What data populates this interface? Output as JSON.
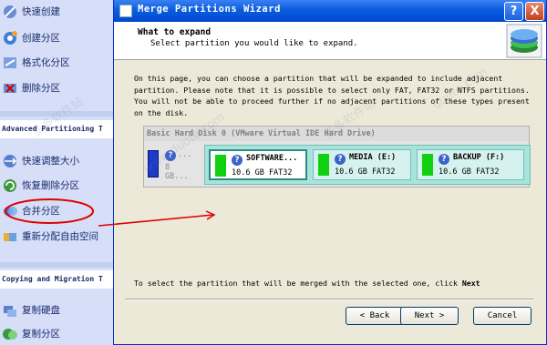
{
  "sidebar": {
    "items_top": [
      {
        "label": "快速创建",
        "icon": "wizard-icon"
      },
      {
        "label": "创建分区",
        "icon": "create-partition-icon"
      },
      {
        "label": "格式化分区",
        "icon": "format-partition-icon"
      },
      {
        "label": "删除分区",
        "icon": "delete-partition-icon"
      }
    ],
    "section_advanced": "Advanced Partitioning T",
    "items_advanced": [
      {
        "label": "快速调整大小",
        "icon": "resize-icon"
      },
      {
        "label": "恢复删除分区",
        "icon": "recover-icon"
      },
      {
        "label": "合并分区",
        "icon": "merge-icon"
      },
      {
        "label": "重新分配自由空间",
        "icon": "redistribute-icon"
      }
    ],
    "section_copy": "Copying and Migration T",
    "items_copy": [
      {
        "label": "复制硬盘",
        "icon": "copy-disk-icon"
      },
      {
        "label": "复制分区",
        "icon": "copy-partition-icon"
      }
    ]
  },
  "window": {
    "title": "Merge Partitions Wizard",
    "help_glyph": "?",
    "close_glyph": "X"
  },
  "header": {
    "title": "What to expand",
    "subtitle": "Select partition you would like to expand."
  },
  "description": [
    "On this page, you can choose a partition that will be expanded to include adjacent",
    "partition. Please note that it is possible to select only FAT, FAT32 or NTFS partitions.",
    "You will not be able to proceed further if no adjacent partitions of these types present",
    "on the disk."
  ],
  "disk": {
    "title": "Basic Hard Disk 0 (VMware Virtual IDE Hard Drive)",
    "small_partition": {
      "dots": "...",
      "size": "8 GB..."
    },
    "partitions": [
      {
        "name": "SOFTWARE...",
        "size": "10.6 GB FAT32",
        "selected": true
      },
      {
        "name": "MEDIA (E:)",
        "size": "10.6 GB FAT32",
        "selected": false
      },
      {
        "name": "BACKUP (F:)",
        "size": "10.6 GB FAT32",
        "selected": false
      }
    ]
  },
  "bottom": {
    "text_prefix": "To select the partition that will be merged with the selected one, click ",
    "text_bold": "Next"
  },
  "buttons": {
    "back": "< Back",
    "next": "Next >",
    "cancel": "Cancel"
  },
  "colors": {
    "titlebar": "#0a5ddf",
    "annotation": "#e00000",
    "partition_fill": "#11d011"
  },
  "watermarks": [
    "多多软件站",
    "多多软件站",
    "www.duote.com",
    "duote.com"
  ]
}
